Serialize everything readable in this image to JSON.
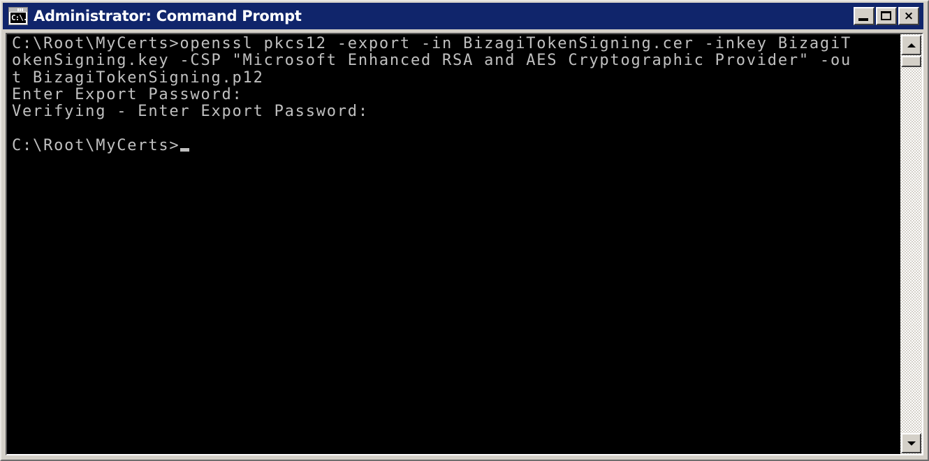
{
  "window": {
    "title": "Administrator: Command Prompt",
    "icon_name": "console-icon",
    "icon_glyph": "C:\\.",
    "titlebar_color": "#10256b",
    "frame_color": "#d4d0c8"
  },
  "titlebar_buttons": {
    "minimize_label": "Minimize",
    "maximize_label": "Maximize",
    "close_label": "Close",
    "close_glyph": "×"
  },
  "console": {
    "background_color": "#000000",
    "foreground_color": "#c0c0c0",
    "columns": 80,
    "prompt": "C:\\Root\\MyCerts>",
    "lines": [
      "C:\\Root\\MyCerts>openssl pkcs12 -export -in BizagiTokenSigning.cer -inkey BizagiT",
      "okenSigning.key -CSP \"Microsoft Enhanced RSA and AES Cryptographic Provider\" -ou",
      "t BizagiTokenSigning.p12",
      "Enter Export Password:",
      "Verifying - Enter Export Password:",
      "",
      "C:\\Root\\MyCerts>"
    ],
    "command": "openssl pkcs12 -export -in BizagiTokenSigning.cer -inkey BizagiTokenSigning.key -CSP \"Microsoft Enhanced RSA and AES Cryptographic Provider\" -out BizagiTokenSigning.p12",
    "prompt_1": "Enter Export Password:",
    "prompt_2": "Verifying - Enter Export Password:",
    "cursor_visible": true
  },
  "scrollbar": {
    "up_arrow_name": "scroll-up",
    "down_arrow_name": "scroll-down",
    "thumb_name": "scroll-thumb",
    "position_percent": 0
  }
}
